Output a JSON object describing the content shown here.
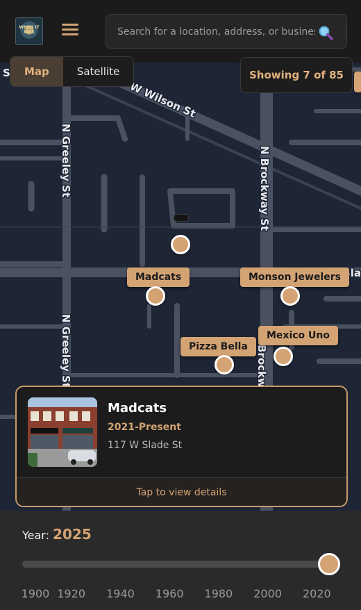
{
  "header": {
    "logo_text": "WHEN IT WAS",
    "search_placeholder": "Search for a location, address, or business"
  },
  "map_type": {
    "map_label": "Map",
    "satellite_label": "Satellite",
    "selected": "Map"
  },
  "showing_label": "Showing 7 of 85",
  "streets": {
    "w_wilson": "W Wilson St",
    "n_greeley_top": "N Greeley St",
    "n_greeley_bottom": "N Greeley St",
    "n_brockway_top": "N Brockway St",
    "n_brockway_bottom": "Brockway St",
    "slade_right": "Slade",
    "left_edge": "S"
  },
  "markers": [
    {
      "label": "Madcats"
    },
    {
      "label": "Monson Jewelers"
    },
    {
      "label": "Mexico Uno"
    },
    {
      "label": "Pizza Bella"
    }
  ],
  "card": {
    "title": "Madcats",
    "years": "2021-Present",
    "address": "117 W Slade St",
    "cta": "Tap to view details"
  },
  "year_slider": {
    "label": "Year:",
    "value": "2025",
    "min": 1900,
    "max": 2025,
    "ticks": [
      "1900",
      "1920",
      "1940",
      "1960",
      "1980",
      "2000",
      "2020"
    ]
  },
  "colors": {
    "accent": "#d4a373",
    "map_bg": "#1e2535",
    "road": "#4a5160"
  }
}
